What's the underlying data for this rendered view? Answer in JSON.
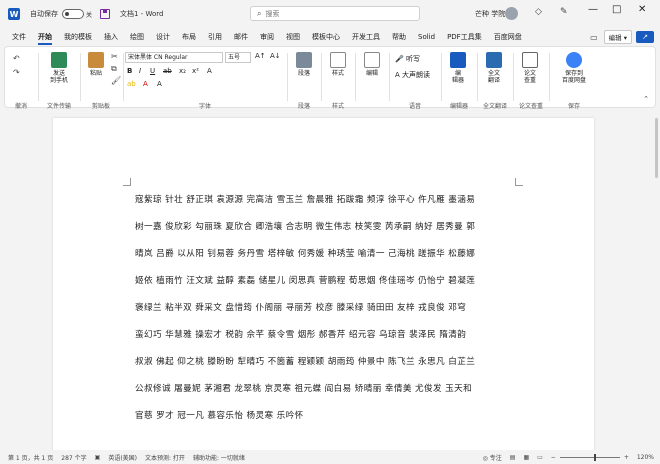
{
  "titlebar": {
    "autosave_label": "自动保存",
    "autosave_state": "关",
    "doc_title": "文档1 - Word",
    "search_placeholder": "搜索",
    "user_name": "芒种 学院"
  },
  "tabs": [
    "文件",
    "开始",
    "我的模板",
    "插入",
    "绘图",
    "设计",
    "布局",
    "引用",
    "邮件",
    "审阅",
    "视图",
    "模板中心",
    "开发工具",
    "帮助",
    "Solid",
    "PDF工具集",
    "百度网盘"
  ],
  "active_tab": "开始",
  "tabs_right": {
    "edit_label": "编辑"
  },
  "ribbon": {
    "groups": {
      "undo": "撤消",
      "file_transfer": "文件传输",
      "clipboard": "剪贴板",
      "font": "字体",
      "paragraph": "段落",
      "styles": "样式",
      "voice": "语音",
      "editor_group": "编辑器",
      "fulltext": "全文翻译",
      "compare": "论文查重",
      "save": "保存"
    },
    "buttons": {
      "send_phone": "发送\n到手机",
      "paste": "粘贴",
      "paragraph": "段落",
      "styles": "样式",
      "edit": "编辑",
      "dictate": "听写",
      "read_aloud": "大声朗读",
      "editor": "编\n辑器",
      "fulltext": "全文\n翻译",
      "compare": "论文\n查重",
      "save_baidu": "保存到\n百度网盘"
    },
    "font_name": "宋体黑体 CN Regular",
    "font_size": "五号"
  },
  "document": {
    "lines": [
      "寇紫琼 针壮 舒正琪 袁源源 完高洁 雪玉兰 詹晨雅 拓跋霜 频淳 徐平心 仵凡雁 墨涵易",
      "树一嘉 俊欣彩 勾丽珠 夏欣合 卿浩壤 合志明 微生伟志 枝笑雯 芮承嗣 纳好 居秀曼 郭",
      "晴岚 吕爵 以从阳 钊易蓉 务丹雪 塔梓敏 何秀媛 种琇莹 喻清一 己海桃 蹉振华 松藤娜",
      "姬依 植雨竹 汪文斌 益醇 素磊 储星儿 闵思真 菅鹏程 荀思烟 佟佳瑶岑 仍怡宁 碧凝莲",
      "褒绿兰 粘半双 舜采文 盘惜筠 仆阁丽 寻丽芳 校彦 滕采绿 骑田田 友梓 戎良俊 邓穹",
      "蛮幻巧 华慧雅 操宏才 税韵 佘芊 蔡令雪 烟彤 郝香芹 绍元容 乌琼音 裴泽民 隋清韵",
      "叔淑 佛起 仰之桃 滕盼盼 犁晴巧 不箇蓄 程颖颖 胡雨筠 仲景中 陈飞兰 永思凡 白芷兰",
      "公叔修诚 屠曼妮 茅湘君 龙翠桃 京灵寒 祖元蝶 阎白易 矫晴丽 幸倩美 尤俊发 玉天和",
      "官慈 罗才 冠一凡 慕容乐怡 杨灵寒 乐吟怀"
    ]
  },
  "statusbar": {
    "page": "第 1 页，共 1 页",
    "words": "287 个字",
    "language": "英语(美国)",
    "text_predict": "文本预测: 打开",
    "accessibility": "辅助功能: 一切就绪",
    "focus": "专注",
    "zoom": "120%"
  }
}
